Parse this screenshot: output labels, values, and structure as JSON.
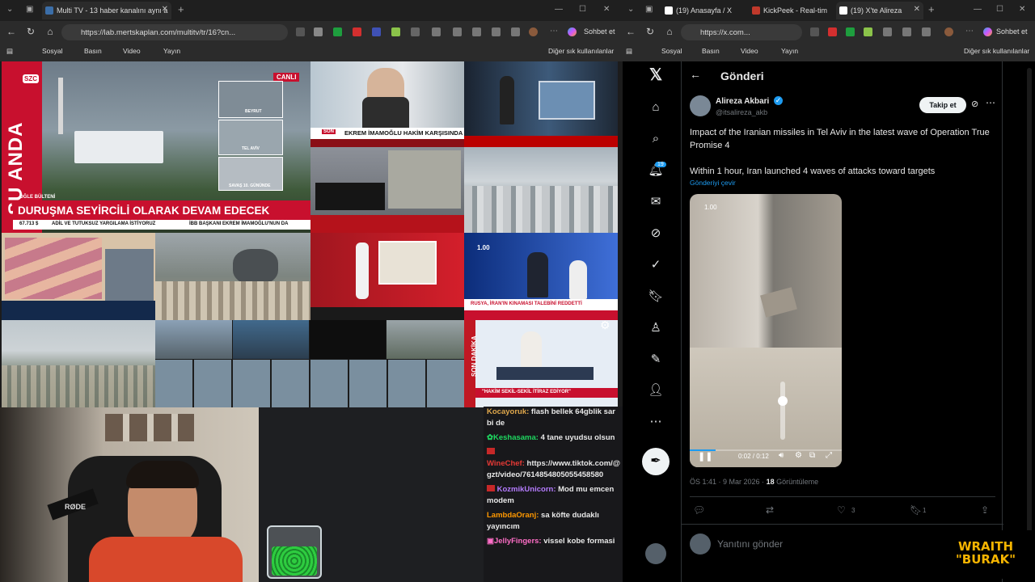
{
  "left_browser": {
    "tab_title": "Multi TV - 13 haber kanalını aynı a",
    "url": "https://lab.mertskaplan.com/multitv/tr/16?cn...",
    "favorites": [
      "Sosyal",
      "Basın",
      "Video",
      "Yayın"
    ],
    "other_favorites": "Diğer sık kullanılanlar",
    "profile_btn": "Sohbet et"
  },
  "right_browser": {
    "tabs": [
      "(19) Anasayfa / X",
      "KickPeek - Real-tim",
      "(19) X'te Alireza"
    ],
    "url": "https://x.com...",
    "favorites": [
      "Sosyal",
      "Basın",
      "Video",
      "Yayın"
    ],
    "other_favorites": "Diğer sık kullanılanlar",
    "profile_btn": "Sohbet et"
  },
  "tv": {
    "szc_logo": "SZC",
    "su_anda": "ŞU ANDA",
    "canli": "CANLI",
    "beyrut": "BEYRUT",
    "tel_aviv": "TEL AVİV",
    "savas": "SAVAŞ 10. GÜNÜNDE",
    "ogle": "ÖĞLE BÜLTENİ",
    "headline": "DURUŞMA SEYİRCİLİ OLARAK DEVAM EDECEK",
    "ticker": "ADİL VE TUTUKSUZ YARGILAMA İSTİYORUZ",
    "ticker2": "İBB BAŞKANI EKREM İMAMOĞLU'NUN DA",
    "price": "67.713 $",
    "ekrem": "EKREM İMAMOĞLU HAKİM KARŞISINDA",
    "son": "SON",
    "rusya": "RUSYA, İRAN'IN KINAMASI TALEBİNİ REDDETTİ",
    "son_dakika": "SON DAKİKA",
    "hakim": "\"HAKİM SEKİL-SEKİL İTİRAZ EDİYOR\""
  },
  "chat": [
    {
      "user": "Kocayoruk:",
      "text": "flash bellek 64gblik sar bi de",
      "color": "#e0a84c"
    },
    {
      "user": "Keshasama:",
      "text": "4 tane uyudsu olsun",
      "color": "#1ed760"
    },
    {
      "user": "WineChef:",
      "text": "https://www.tiktok.com/@gzt/video/7614854805055458580",
      "color": "#e53935"
    },
    {
      "user": "KozmikUnicorn:",
      "text": "Mod mu emcen modem",
      "color": "#b57cff"
    },
    {
      "user": "LambdaOranj:",
      "text": "sa köfte dudaklı yayıncım",
      "color": "#ff9800"
    },
    {
      "user": "JellyFingers:",
      "text": "vissel kobe formasi",
      "color": "#ff6ec7"
    }
  ],
  "streamer_badge": {
    "line1": "WRAITH",
    "line2": "\"BURAK\""
  },
  "x": {
    "header": "Gönderi",
    "author_name": "Alireza Akbari",
    "author_handle": "@itsalireza_akb",
    "follow": "Takip et",
    "text1": "Impact of the  Iranian missiles in Tel Aviv in the latest wave of Operation True Promise 4",
    "text2": "Within 1 hour, Iran launched 4 waves of attacks toward targets",
    "translate": "Gönderiyi çevir",
    "speed": "1.00",
    "video_time": "0:02 / 0:12",
    "timestamp": "ÖS 1:41 · 9 Mar 2026 ·",
    "views_count": "18",
    "views_label": "Görüntüleme",
    "like_count": "3",
    "bookmark_count": "1",
    "reply_placeholder": "Yanıtını gönder",
    "notif_badge": "19",
    "video_progress": 0.17
  }
}
